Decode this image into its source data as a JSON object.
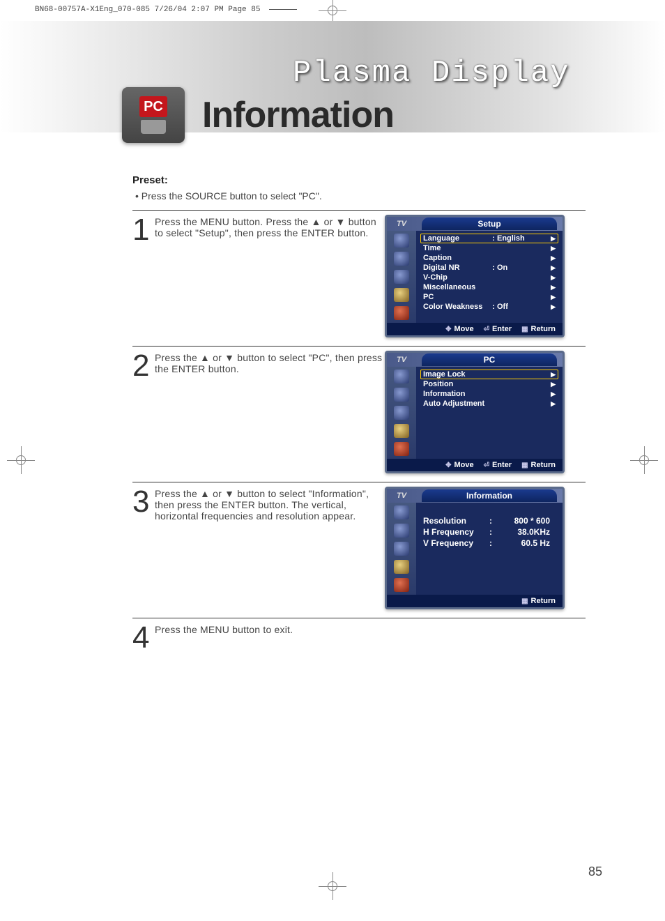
{
  "print_header": "BN68-00757A-X1Eng_070-085  7/26/04  2:07 PM  Page 85",
  "banner_text": "Plasma Display",
  "pc_badge": "PC",
  "page_title": "Information",
  "preset_heading": "Preset:",
  "preset_bullet": "•  Press the SOURCE button to select \"PC\".",
  "steps": [
    {
      "num": "1",
      "text": "Press the MENU button. Press the ▲ or ▼ button to select \"Setup\", then press the ENTER button."
    },
    {
      "num": "2",
      "text": "Press the ▲ or ▼ button to select \"PC\", then press the ENTER button."
    },
    {
      "num": "3",
      "text": "Press the ▲ or ▼ button to select \"Information\", then press the ENTER button. The vertical, horizontal frequencies and resolution appear."
    },
    {
      "num": "4",
      "text": "Press the MENU button to exit."
    }
  ],
  "osd1": {
    "tv": "TV",
    "title": "Setup",
    "items": [
      {
        "label": "Language",
        "value": "English",
        "selected": true
      },
      {
        "label": "Time",
        "value": ""
      },
      {
        "label": "Caption",
        "value": ""
      },
      {
        "label": "Digital NR",
        "value": "On"
      },
      {
        "label": "V-Chip",
        "value": ""
      },
      {
        "label": "Miscellaneous",
        "value": ""
      },
      {
        "label": "PC",
        "value": ""
      },
      {
        "label": "Color Weakness",
        "value": "Off"
      }
    ],
    "footer": {
      "move": "Move",
      "enter": "Enter",
      "ret": "Return"
    }
  },
  "osd2": {
    "tv": "TV",
    "title": "PC",
    "items": [
      {
        "label": "Image Lock",
        "selected": true
      },
      {
        "label": "Position"
      },
      {
        "label": "Information"
      },
      {
        "label": "Auto Adjustment"
      }
    ],
    "footer": {
      "move": "Move",
      "enter": "Enter",
      "ret": "Return"
    }
  },
  "osd3": {
    "tv": "TV",
    "title": "Information",
    "rows": [
      {
        "label": "Resolution",
        "value": "800 * 600"
      },
      {
        "label": "H Frequency",
        "value": "38.0KHz"
      },
      {
        "label": "V Frequency",
        "value": "60.5 Hz"
      }
    ],
    "footer": {
      "ret": "Return"
    }
  },
  "page_number": "85"
}
